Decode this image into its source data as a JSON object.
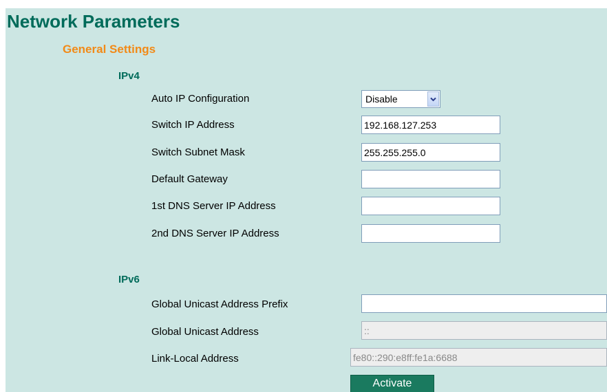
{
  "page": {
    "title": "Network Parameters",
    "section_title": "General Settings"
  },
  "ipv4": {
    "heading": "IPv4",
    "auto_ip": {
      "label": "Auto IP Configuration",
      "selected": "Disable",
      "icon": "chevron-down-icon"
    },
    "switch_ip": {
      "label": "Switch IP Address",
      "value": "192.168.127.253"
    },
    "subnet_mask": {
      "label": "Switch Subnet Mask",
      "value": "255.255.255.0"
    },
    "gateway": {
      "label": "Default Gateway",
      "value": ""
    },
    "dns1": {
      "label": "1st DNS Server IP Address",
      "value": ""
    },
    "dns2": {
      "label": "2nd DNS Server IP Address",
      "value": ""
    }
  },
  "ipv6": {
    "heading": "IPv6",
    "global_prefix": {
      "label": "Global Unicast Address Prefix",
      "value": ""
    },
    "global_address": {
      "label": "Global Unicast Address",
      "value": "::"
    },
    "link_local": {
      "label": "Link-Local Address",
      "value": "fe80::290:e8ff:fe1a:6688"
    }
  },
  "actions": {
    "activate_label": "Activate"
  },
  "colors": {
    "background": "#cce6e3",
    "title": "#006b5a",
    "section_title": "#f28a17",
    "button": "#1a7a5f"
  }
}
